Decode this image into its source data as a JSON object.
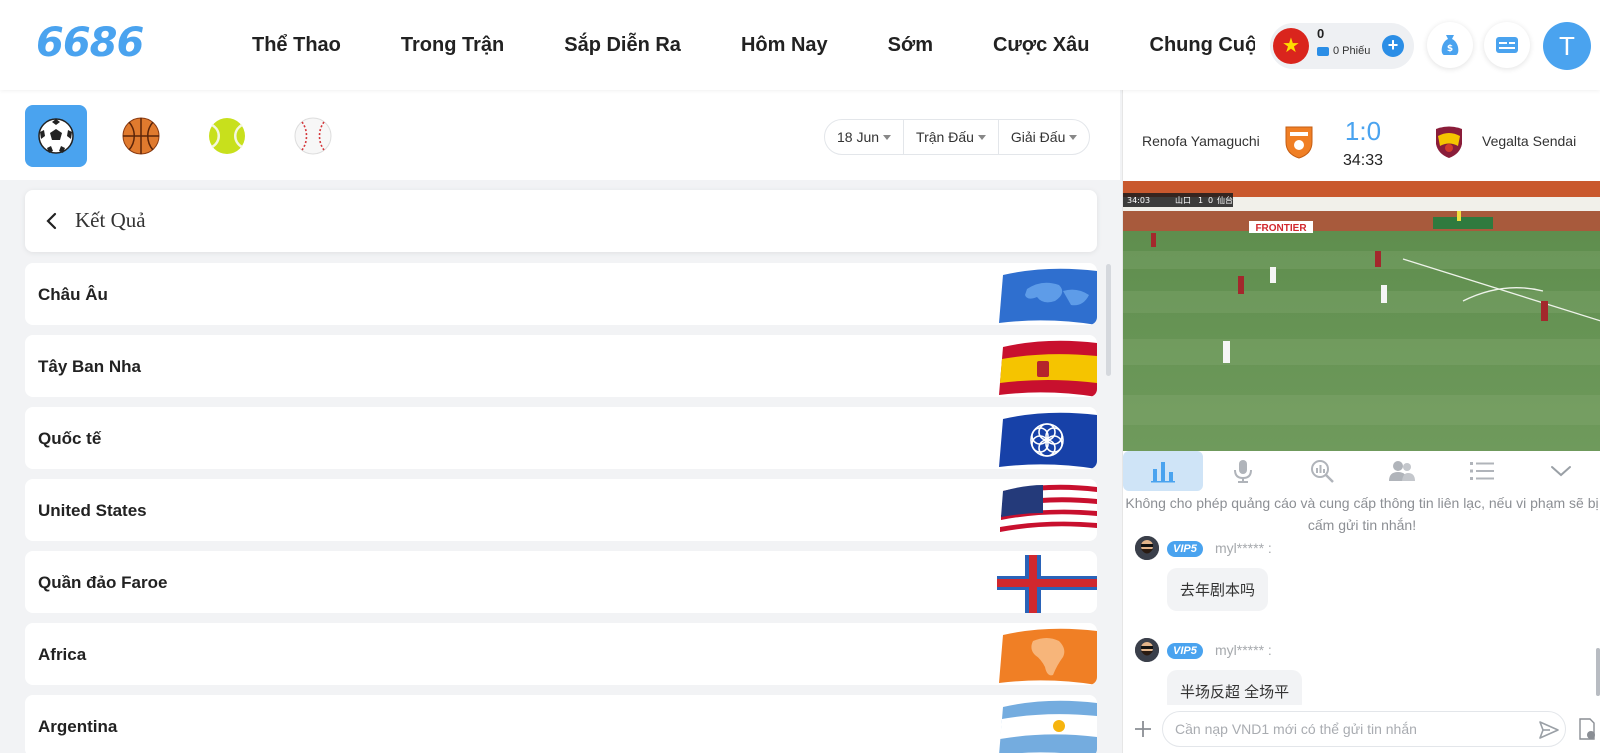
{
  "brand": {
    "logo": "6686",
    "accent": "#4aa3ef"
  },
  "nav": {
    "items": [
      "Thể Thao",
      "Trong Trận",
      "Sắp Diễn Ra",
      "Hôm Nay",
      "Sớm",
      "Cược Xâu",
      "Chung Cuộc"
    ]
  },
  "wallet": {
    "amount": "0",
    "tickets": "0 Phiếu",
    "flag_icon": "vietnam-flag-icon"
  },
  "user": {
    "initial": "T"
  },
  "sports": {
    "tabs": [
      {
        "name": "soccer",
        "icon": "soccer-ball-icon",
        "active": true
      },
      {
        "name": "basketball",
        "icon": "basketball-icon",
        "active": false
      },
      {
        "name": "tennis",
        "icon": "tennis-ball-icon",
        "active": false
      },
      {
        "name": "baseball",
        "icon": "baseball-icon",
        "active": false
      }
    ]
  },
  "filters": {
    "date": "18 Jun",
    "match": "Trận Đấu",
    "league": "Giải Đấu"
  },
  "results": {
    "title": "Kết Quả",
    "countries": [
      {
        "name": "Châu Âu",
        "flag": "europe-flag"
      },
      {
        "name": "Tây Ban Nha",
        "flag": "spain-flag"
      },
      {
        "name": "Quốc tế",
        "flag": "international-flag"
      },
      {
        "name": "United States",
        "flag": "usa-flag"
      },
      {
        "name": "Quần đảo Faroe",
        "flag": "faroe-flag"
      },
      {
        "name": "Africa",
        "flag": "africa-flag"
      },
      {
        "name": "Argentina",
        "flag": "argentina-flag"
      }
    ]
  },
  "match": {
    "home": "Renofa Yamaguchi",
    "away": "Vegalta Sendai",
    "score": "1:0",
    "time": "34:33"
  },
  "video": {
    "overlay_time": "34:03",
    "overlay_home": "山口",
    "overlay_away": "仙台",
    "overlay_home_score": "1",
    "overlay_away_score": "0",
    "board_text": "FRONTIER"
  },
  "chat": {
    "notice": "Không cho phép quảng cáo và cung cấp thông tin liên lạc, nếu vi phạm sẽ bị cấm gửi tin nhắn!",
    "messages": [
      {
        "vip": "VIP5",
        "user": "myl***** :",
        "text": "去年剧本吗"
      },
      {
        "vip": "VIP5",
        "user": "myl***** :",
        "text": "半场反超 全场平"
      }
    ],
    "input_placeholder": "Cần nạp VND1 mới có thể gửi tin nhắn"
  }
}
